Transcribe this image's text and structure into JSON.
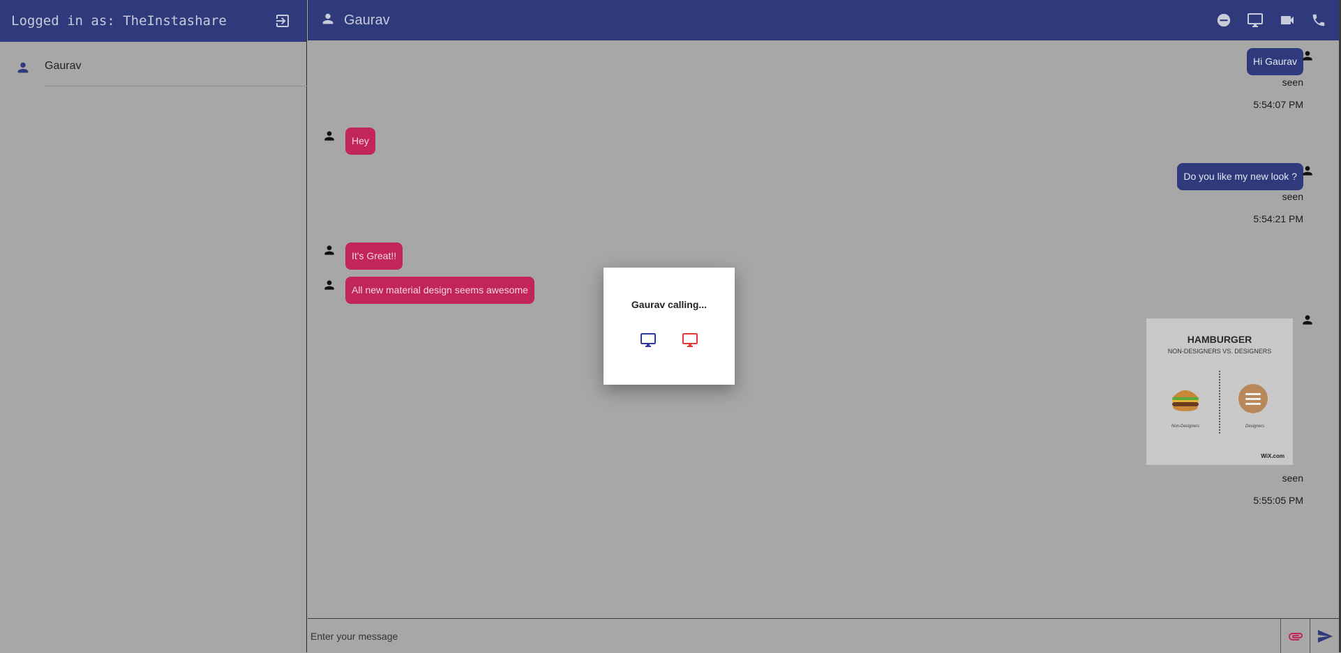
{
  "sidebar": {
    "logged_in_text": "Logged in as: TheInstashare",
    "contacts": [
      {
        "name": "Gaurav"
      }
    ]
  },
  "chat": {
    "title": "Gaurav",
    "messages": [
      {
        "direction": "out",
        "text": "Hi Gaurav",
        "status": "seen",
        "time": "5:54:07 PM"
      },
      {
        "direction": "in",
        "text": "Hey"
      },
      {
        "direction": "out",
        "text": "Do you like my new look ?",
        "status": "seen",
        "time": "5:54:21 PM"
      },
      {
        "direction": "in",
        "text": "It's Great!!"
      },
      {
        "direction": "in",
        "text": "All new material design seems awesome"
      },
      {
        "direction": "out",
        "type": "image",
        "status": "seen",
        "time": "5:55:05 PM",
        "image": {
          "title": "HAMBURGER",
          "subtitle": "NON-DESIGNERS VS. DESIGNERS",
          "left_label": "Non-Designers",
          "right_label": "Designers",
          "brand": "WiX.com"
        }
      }
    ]
  },
  "input": {
    "placeholder": "Enter your message"
  },
  "modal": {
    "text": "Gaurav calling..."
  },
  "colors": {
    "primary": "#2e3a7b",
    "incoming": "#c2255c",
    "backdrop": "#a7a7a7",
    "accept": "#2e3a9b",
    "reject": "#e53935"
  }
}
